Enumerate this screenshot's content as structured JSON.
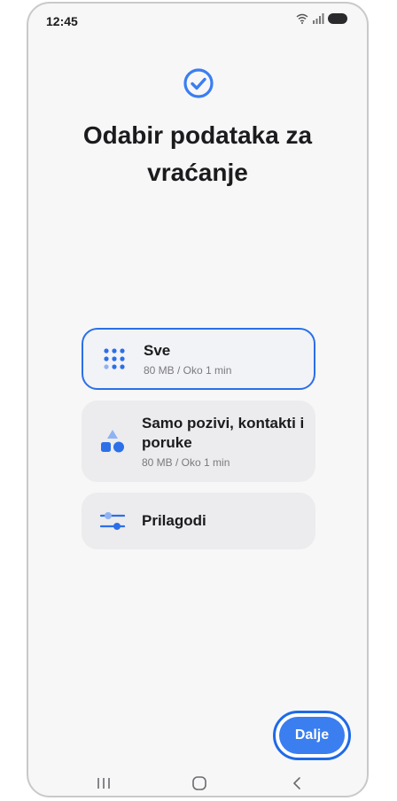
{
  "status_bar": {
    "time": "12:45",
    "icons": [
      "wifi-icon",
      "signal-icon",
      "battery-icon"
    ]
  },
  "header": {
    "icon": "check-circle-icon",
    "title": "Odabir podataka za vraćanje"
  },
  "options": [
    {
      "icon": "grid-dots-icon",
      "title": "Sve",
      "subtitle": "80 MB / Oko 1 min",
      "selected": true
    },
    {
      "icon": "shapes-icon",
      "title": "Samo pozivi, kontakti i poruke",
      "subtitle": "80 MB / Oko 1 min",
      "selected": false
    },
    {
      "icon": "sliders-icon",
      "title": "Prilagodi",
      "subtitle": "",
      "selected": false
    }
  ],
  "footer": {
    "next_label": "Dalje"
  },
  "nav_bar": {
    "items": [
      "recent-apps-icon",
      "home-icon",
      "back-icon"
    ]
  },
  "colors": {
    "accent": "#3a7ef0",
    "selected_border": "#2c6fe8",
    "option_bg": "#ececee",
    "text_primary": "#1b1b1d",
    "text_secondary": "#7a7a7e"
  }
}
